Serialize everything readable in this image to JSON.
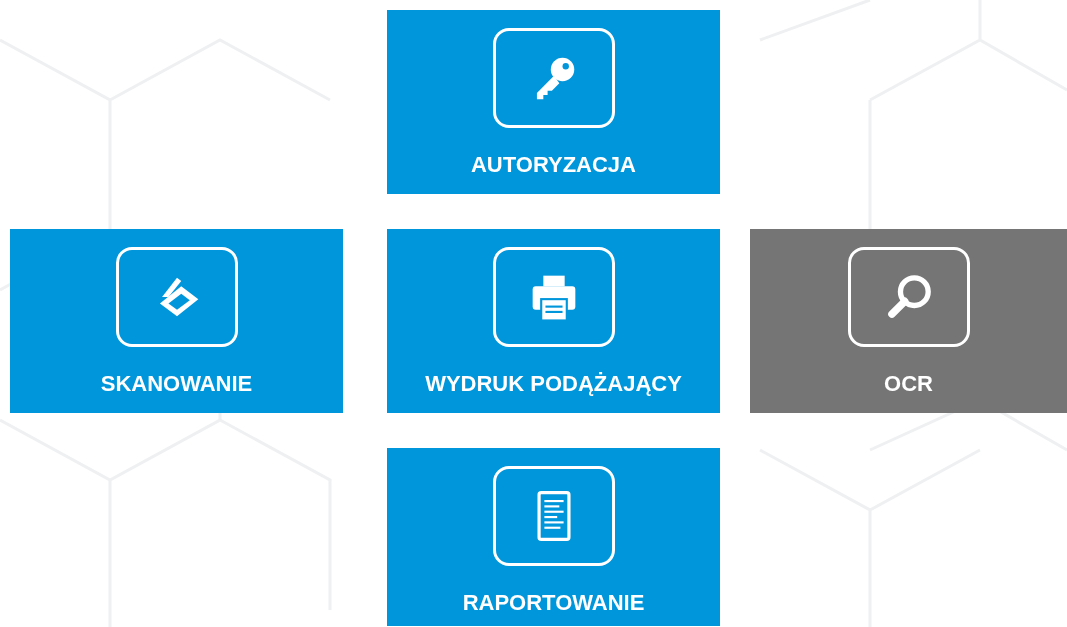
{
  "tiles": [
    {
      "label": "AUTORYZACJA",
      "kind": "key",
      "color": "#0096db"
    },
    {
      "label": "SKANOWANIE",
      "kind": "scanner",
      "color": "#0096db"
    },
    {
      "label": "WYDRUK PODĄŻAJĄCY",
      "kind": "printer",
      "color": "#0096db"
    },
    {
      "label": "OCR",
      "kind": "search",
      "color": "#757575"
    },
    {
      "label": "RAPORTOWANIE",
      "kind": "document",
      "color": "#0096db"
    }
  ]
}
